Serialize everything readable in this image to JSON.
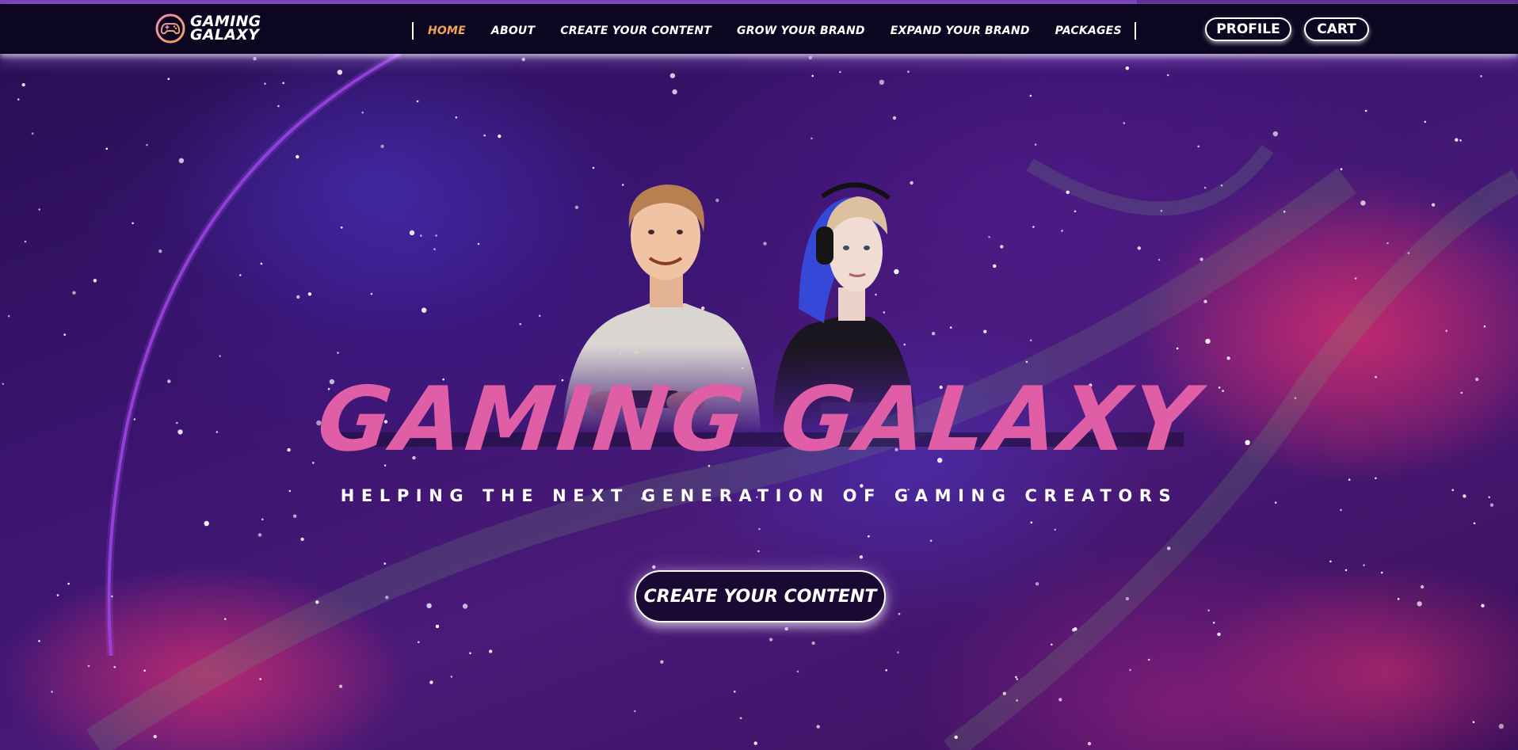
{
  "brand": {
    "line1": "GAMING",
    "line2": "GALAXY"
  },
  "nav": {
    "items": [
      {
        "label": "HOME",
        "active": true
      },
      {
        "label": "ABOUT",
        "active": false
      },
      {
        "label": "CREATE YOUR CONTENT",
        "active": false
      },
      {
        "label": "GROW YOUR BRAND",
        "active": false
      },
      {
        "label": "EXPAND YOUR BRAND",
        "active": false
      },
      {
        "label": "PACKAGES",
        "active": false
      }
    ],
    "active_color": "#f2a35c"
  },
  "header_actions": {
    "profile_label": "PROFILE",
    "cart_label": "CART"
  },
  "hero": {
    "title": "GAMING GALAXY",
    "subtitle": "HELPING THE NEXT GENERATION OF GAMING CREATORS",
    "cta_label": "CREATE YOUR CONTENT",
    "title_color": "#df5ea6"
  },
  "colors": {
    "header_bg": "#0c0620",
    "hero_bg": "#3b1470",
    "accent_pink": "#df5ea6"
  }
}
